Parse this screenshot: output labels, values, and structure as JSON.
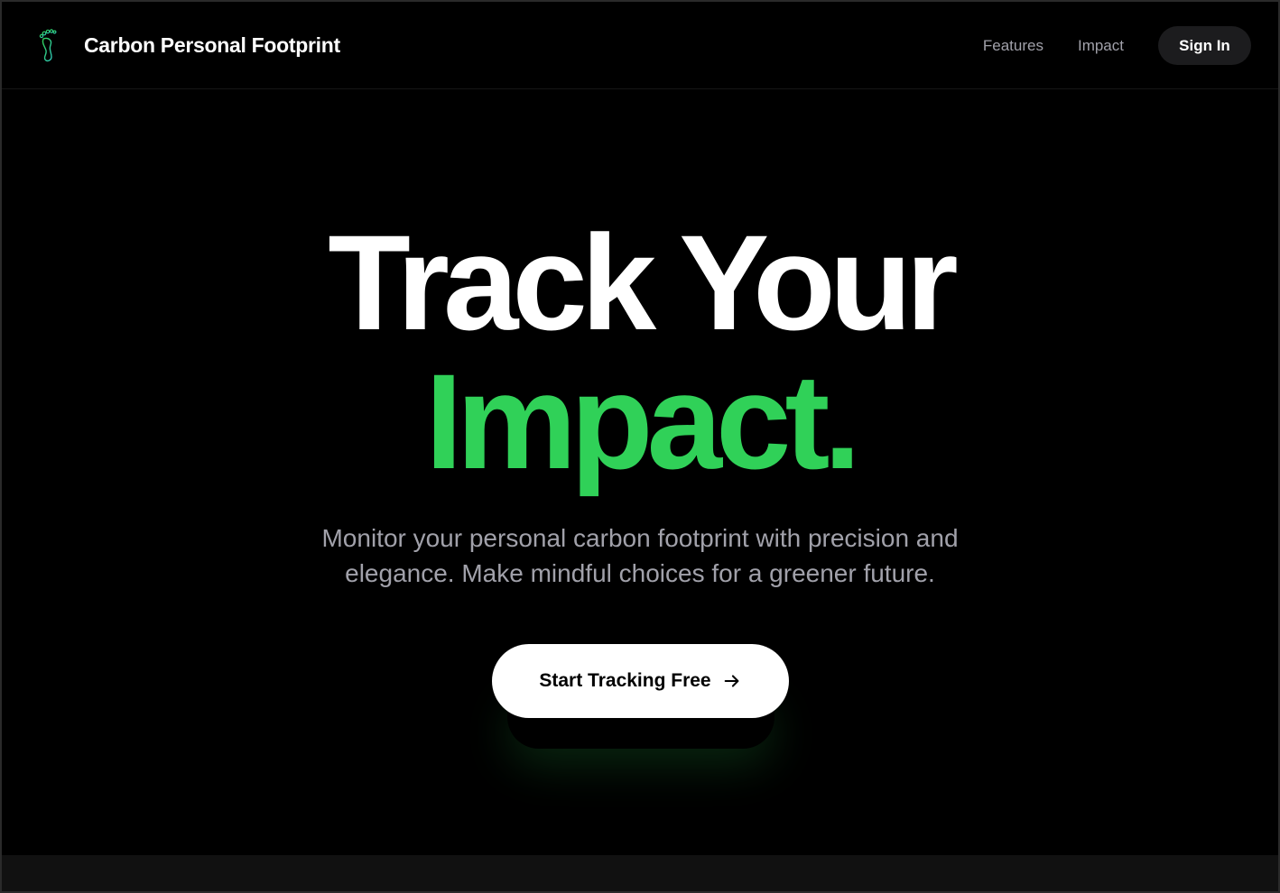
{
  "header": {
    "brand_name": "Carbon Personal Footprint",
    "brand_icon": "footprint-icon",
    "nav_links": [
      {
        "label": "Features"
      },
      {
        "label": "Impact"
      }
    ],
    "signin_label": "Sign In"
  },
  "hero": {
    "headline": "Track Your",
    "headline_accent": "Impact.",
    "subtitle": "Monitor your personal carbon footprint with precision and elegance. Make mindful choices for a greener future.",
    "cta_label": "Start Tracking Free",
    "cta_icon": "arrow-right-icon"
  },
  "colors": {
    "background": "#000000",
    "accent": "#30d158",
    "text_primary": "#ffffff",
    "text_muted": "#a1a1aa",
    "button_dark": "#1c1c1e"
  }
}
